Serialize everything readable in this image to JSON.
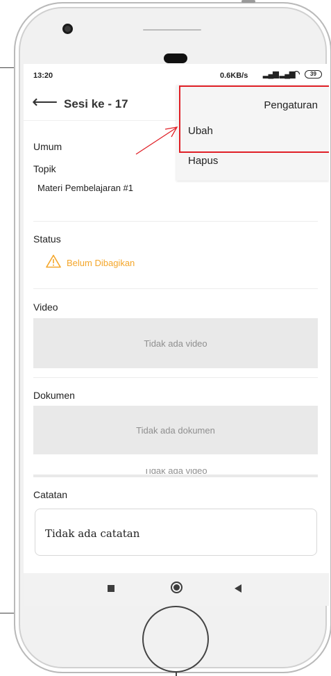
{
  "status_bar": {
    "time": "13:20",
    "network_speed": "0.6KB/s",
    "battery": "39",
    "icons": [
      "signal-icon",
      "signal-icon",
      "wifi-icon",
      "battery-icon"
    ]
  },
  "app_bar": {
    "title": "Sesi ke - 17"
  },
  "content": {
    "section_general": "Umum",
    "topic_label": "Topik",
    "topic_value": "Materi Pembelajaran #1",
    "status_label": "Status",
    "status_value": "Belum Dibagikan",
    "video_label": "Video",
    "video_empty": "Tidak ada video",
    "document_label": "Dokumen",
    "document_empty": "Tidak ada dokumen",
    "video_empty_cut": "Tidak ada video",
    "notes_label": "Catatan",
    "notes_empty": "Tidak ada catatan"
  },
  "menu": {
    "header": "Pengaturan",
    "items": [
      "Ubah",
      "Hapus"
    ]
  },
  "colors": {
    "warning": "#f4a62a",
    "highlight": "#e01f26",
    "empty_box": "#e9e9e9"
  }
}
